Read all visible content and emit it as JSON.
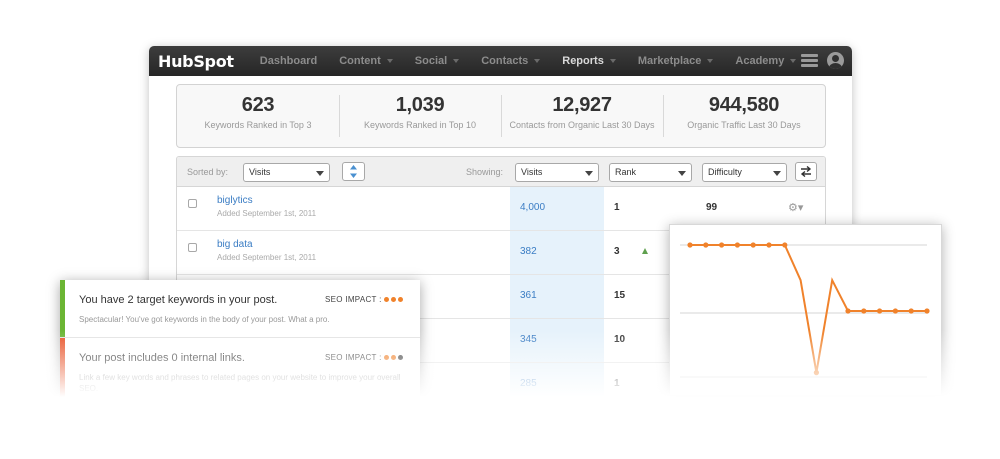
{
  "brand": "HubSpot",
  "nav": {
    "items": [
      {
        "label": "Dashboard",
        "caret": false,
        "active": false
      },
      {
        "label": "Content",
        "caret": true,
        "active": false
      },
      {
        "label": "Social",
        "caret": true,
        "active": false
      },
      {
        "label": "Contacts",
        "caret": true,
        "active": false
      },
      {
        "label": "Reports",
        "caret": true,
        "active": true
      },
      {
        "label": "Marketplace",
        "caret": true,
        "active": false
      },
      {
        "label": "Academy",
        "caret": true,
        "active": false
      }
    ],
    "icons": [
      "menu-icon",
      "user-icon"
    ]
  },
  "stats": [
    {
      "value": "623",
      "label": "Keywords Ranked in Top 3"
    },
    {
      "value": "1,039",
      "label": "Keywords Ranked in Top 10"
    },
    {
      "value": "12,927",
      "label": "Contacts from Organic Last 30 Days"
    },
    {
      "value": "944,580",
      "label": "Organic Traffic Last 30 Days"
    }
  ],
  "controls": {
    "sorted_by_label": "Sorted by:",
    "sorted_by_value": "Visits",
    "showing_label": "Showing:",
    "col1": "Visits",
    "col2": "Rank",
    "col3": "Difficulty"
  },
  "rows": [
    {
      "keyword": "biglytics",
      "added": "Added September 1st, 2011",
      "visits": "4,000",
      "rank": "1",
      "difficulty": "99",
      "rank_up": false
    },
    {
      "keyword": "big data",
      "added": "Added September 1st, 2011",
      "visits": "382",
      "rank": "3",
      "difficulty": "",
      "rank_up": true
    },
    {
      "keyword": "",
      "added": "",
      "visits": "361",
      "rank": "15",
      "difficulty": "",
      "rank_up": false
    },
    {
      "keyword": "",
      "added": "",
      "visits": "345",
      "rank": "10",
      "difficulty": "",
      "rank_up": false
    },
    {
      "keyword": "",
      "added": "",
      "visits": "285",
      "rank": "1",
      "difficulty": "",
      "rank_up": false
    }
  ],
  "seo": [
    {
      "heading": "You have 2 target keywords in your post.",
      "impact_label": "SEO IMPACT :",
      "impact_dots": 3,
      "text": "Spectacular! You've got keywords in the body of your post. What a pro.",
      "bar_color": "#6bb534"
    },
    {
      "heading": "Your post includes 0 internal links.",
      "impact_label": "SEO IMPACT :",
      "impact_dots": 2,
      "text": "Link a few key words and phrases to related pages on your website to improve your overall SEO.",
      "bar_color": "#e8542a"
    }
  ],
  "colors": {
    "accent": "#f0822b",
    "link": "#3b7dc4",
    "nav_bg": "#2e2e2e"
  },
  "chart_data": {
    "type": "line",
    "title": "",
    "xlabel": "",
    "ylabel": "",
    "grid": true,
    "ylim": [
      0,
      3
    ],
    "series": [
      {
        "values": [
          3,
          3,
          3,
          3,
          3,
          3,
          3,
          2.2,
          0.1,
          2.2,
          1.5,
          1.5,
          1.5,
          1.5,
          1.5,
          1.5
        ]
      }
    ]
  }
}
